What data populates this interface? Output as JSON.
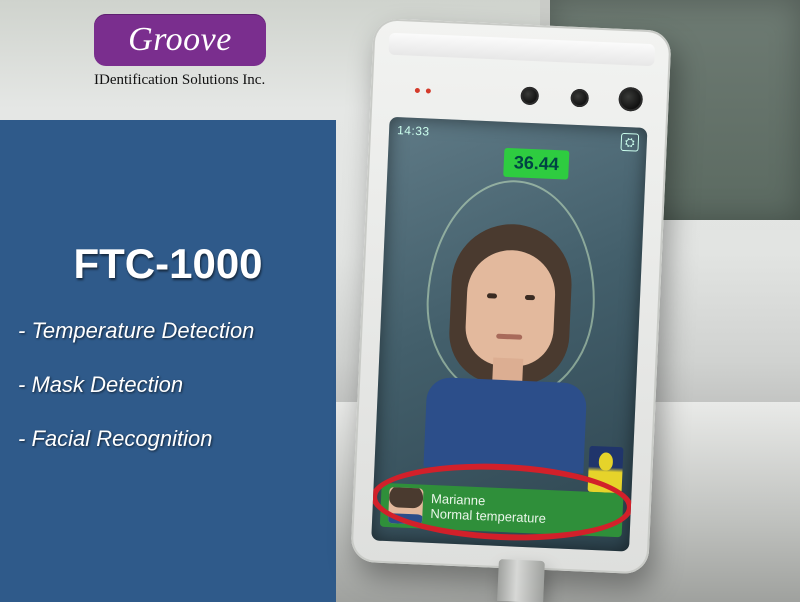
{
  "logo": {
    "brand": "Groove",
    "tagline": "IDentification Solutions Inc."
  },
  "panel": {
    "title": "FTC-1000",
    "features": [
      "- Temperature Detection",
      "- Mask Detection",
      "- Facial Recognition"
    ],
    "bg_color": "#2f5a8a"
  },
  "device": {
    "time": "14:33",
    "temperature_reading": "36.44",
    "result": {
      "name": "Marianne",
      "status": "Normal temperature"
    },
    "accent_ok": "#2ecc40",
    "result_bar": "#2f8f3a",
    "highlight_ring": "#d2202a"
  }
}
